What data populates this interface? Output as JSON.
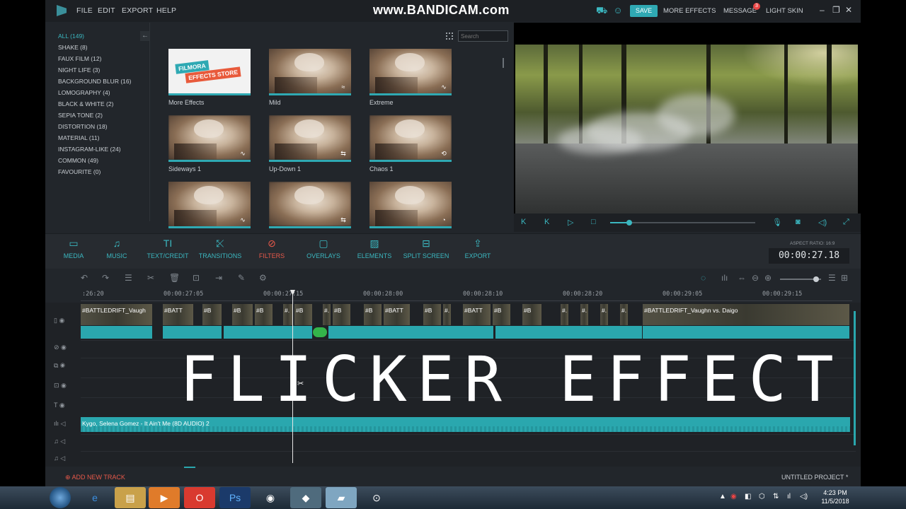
{
  "menu": [
    "FILE",
    "EDIT",
    "EXPORT",
    "HELP"
  ],
  "watermark": "www.BANDICAM.com",
  "topright": {
    "save": "SAVE",
    "more_effects": "MORE EFFECTS",
    "message": "MESSAGE",
    "message_count": "3",
    "light_skin": "LIGHT SKIN"
  },
  "categories": [
    "ALL (149)",
    "SHAKE (8)",
    "FAUX FILM (12)",
    "NIGHT LIFE (3)",
    "BACKGROUND BLUR (16)",
    "LOMOGRAPHY (4)",
    "BLACK & WHITE (2)",
    "SEPIA TONE (2)",
    "DISTORTION (18)",
    "MATERIAL (11)",
    "INSTAGRAM-LIKE (24)",
    "COMMON (49)",
    "FAVOURITE (0)"
  ],
  "search": {
    "placeholder": "Search"
  },
  "effects": [
    {
      "label": "More Effects",
      "store_line1": "FILMORA",
      "store_line2": "EFFECTS STORE"
    },
    {
      "label": "Mild"
    },
    {
      "label": "Extreme"
    },
    {
      "label": "Sideways 1"
    },
    {
      "label": "Up-Down 1"
    },
    {
      "label": "Chaos 1"
    },
    {
      "label": ""
    },
    {
      "label": ""
    },
    {
      "label": ""
    }
  ],
  "preview": {
    "progress": 0.13
  },
  "tabs": [
    "MEDIA",
    "MUSIC",
    "TEXT/CREDIT",
    "TRANSITIONS",
    "FILTERS",
    "OVERLAYS",
    "ELEMENTS",
    "SPLIT SCREEN",
    "EXPORT"
  ],
  "active_tab": "FILTERS",
  "aspect_ratio": "ASPECT RATIO: 16:9",
  "timecode": "00:00:27.18",
  "ruler": [
    ":26:20",
    "00:00:27:05",
    "00:00:27:15",
    "00:00:28:00",
    "00:00:28:10",
    "00:00:28:20",
    "00:00:29:05",
    "00:00:29:15"
  ],
  "clips": {
    "first": "#BATTLEDRIFT_Vaugh",
    "batt": "#BATT",
    "b": "#B",
    "hash": "#.",
    "last": "#BATTLEDRIFT_Vaughn vs. Daigo"
  },
  "audio_label": "Kygo, Selena Gomez - It Ain't Me (8D AUDIO) 2",
  "overlay_title": "FLICKER EFFECT",
  "footer": {
    "add_track": "ADD NEW TRACK",
    "project": "UNTITLED PROJECT *"
  },
  "clock": {
    "time": "4:23 PM",
    "date": "11/5/2018"
  },
  "colors": {
    "accent": "#2fa9b3",
    "active": "#e8594a",
    "background": "#22262b"
  }
}
